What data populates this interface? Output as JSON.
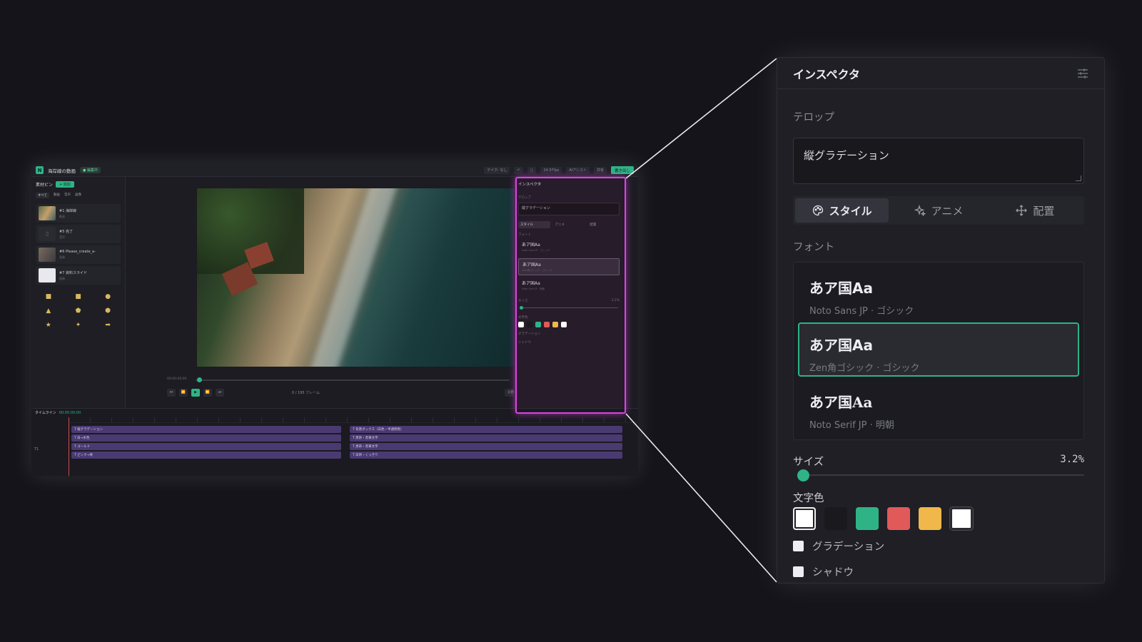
{
  "editor": {
    "title": "海岸線の動画",
    "badge": "● 編集中",
    "toolbar": {
      "preset_value": "テイク: なし",
      "fps_value": "24.97fps",
      "ai_assist": "AIアシスト",
      "share": "共有",
      "export": "書き出し"
    },
    "media_bin": {
      "title": "素材ビン",
      "add_label": "+ 追加",
      "filters": [
        "すべて",
        "動画",
        "音声",
        "画像"
      ],
      "items": [
        {
          "name": "#1 海岸線",
          "sub": "動画"
        },
        {
          "name": "#5 完了",
          "sub": "音声"
        },
        {
          "name": "#6 Please_create_a-",
          "sub": "画像"
        },
        {
          "name": "#7 資料スライド",
          "sub": "画像"
        }
      ]
    },
    "player": {
      "time_start": "00:00:00:00",
      "time_end": "00:00:08:00",
      "frames": "0 / 195 フレーム",
      "split": "分割",
      "add_telop": "テロップ追加"
    },
    "timeline": {
      "title": "タイムライン",
      "timecode": "00:00:00:00",
      "track": "T1",
      "clips_left": [
        "T 縦グラデーション",
        "T 白→水色",
        "T ゴールド",
        "T ピンク→青"
      ],
      "clips_right": [
        "T 背景ボックス（白色・半透明黒）",
        "T 黒帯・赤黄文字",
        "T 黒帯・赤黄文字",
        "T 白帯・くっきり"
      ]
    }
  },
  "inspector": {
    "title": "インスペクタ",
    "telop_label": "テロップ",
    "telop_text": "縦グラデーション",
    "tabs": [
      {
        "label": "スタイル",
        "icon": "palette-icon",
        "active": true
      },
      {
        "label": "アニメ",
        "icon": "sparkle-icon",
        "active": false
      },
      {
        "label": "配置",
        "icon": "move-icon",
        "active": false
      }
    ],
    "font_label": "フォント",
    "fonts": [
      {
        "sample": "あア国Aa",
        "meta": "Noto Sans JP · ゴシック",
        "selected": false
      },
      {
        "sample": "あア国Aa",
        "meta": "Zen角ゴシック · ゴシック",
        "selected": true
      },
      {
        "sample": "あア国Aa",
        "meta": "Noto Serif JP · 明朝",
        "selected": false
      }
    ],
    "size_label": "サイズ",
    "size_value": "3.2%",
    "size_fraction": 0.02,
    "color_label": "文字色",
    "colors": [
      "#ffffff",
      "#1a1a1e",
      "#2fb386",
      "#e05a5a",
      "#f0b84a",
      "#ffffff"
    ],
    "gradient_label": "グラデーション",
    "shadow_label": "シャドウ",
    "accent": "#2fb386",
    "highlight": "#e040e8"
  }
}
